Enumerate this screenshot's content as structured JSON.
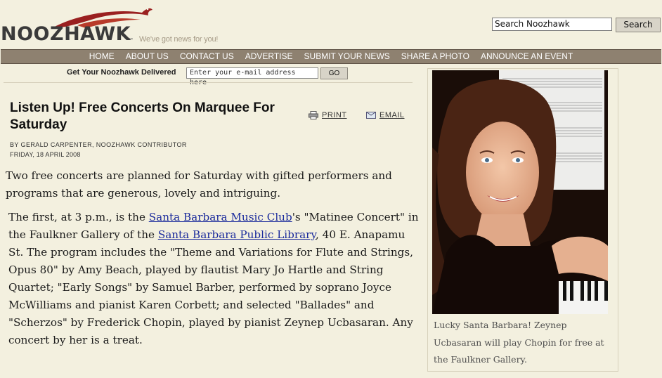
{
  "header": {
    "logo_text": "NOOZHAWK",
    "logo_tm": "™",
    "tagline": "We've got news for you!",
    "search": {
      "value": "Search Noozhawk",
      "button_label": "Search"
    }
  },
  "nav": {
    "items": [
      "HOME",
      "ABOUT US",
      "CONTACT US",
      "ADVERTISE",
      "SUBMIT YOUR NEWS",
      "SHARE A PHOTO",
      "ANNOUNCE AN EVENT"
    ]
  },
  "subscribe": {
    "label": "Get Your Noozhawk Delivered",
    "placeholder": "Enter your e-mail address here",
    "button_label": "GO"
  },
  "article": {
    "title": "Listen Up! Free Concerts On Marquee For Saturday",
    "print_label": "PRINT",
    "email_label": "EMAIL",
    "byline": "BY GERALD CARPENTER, NOOZHAWK CONTRIBUTOR",
    "date": "FRIDAY, 18 APRIL 2008",
    "para1": "Two free concerts are planned for Saturday with gifted performers and programs that are generous, lovely and intriguing.",
    "para2": {
      "t1": "The first, at 3 p.m., is the ",
      "link1": "Santa Barbara Music Club",
      "t2": "'s \"Matinee Concert\" in the Faulkner Gallery of the ",
      "link2": "Santa Barbara Public Library",
      "t3": ", 40 E. Anapamu St. The program includes the \"Theme and Variations for Flute and Strings, Opus 80\" by Amy Beach, played by flautist Mary Jo Hartle and String Quartet; \"Early Songs\" by Samuel Barber, performed by soprano Joyce McWilliams and pianist Karen Corbett; and selected \"Ballades\" and \"Scherzos\" by Frederick Chopin, played by pianist Zeynep Ucbasaran. Any concert by her is a treat."
    }
  },
  "photo": {
    "caption": "Lucky Santa Barbara! Zeynep Ucbasaran will play Chopin for free at the Faulkner Gallery."
  },
  "colors": {
    "page_bg": "#f3f0df",
    "nav_bg": "#8e8170",
    "logo_red": "#9a2020",
    "link": "#1a2a9c"
  }
}
